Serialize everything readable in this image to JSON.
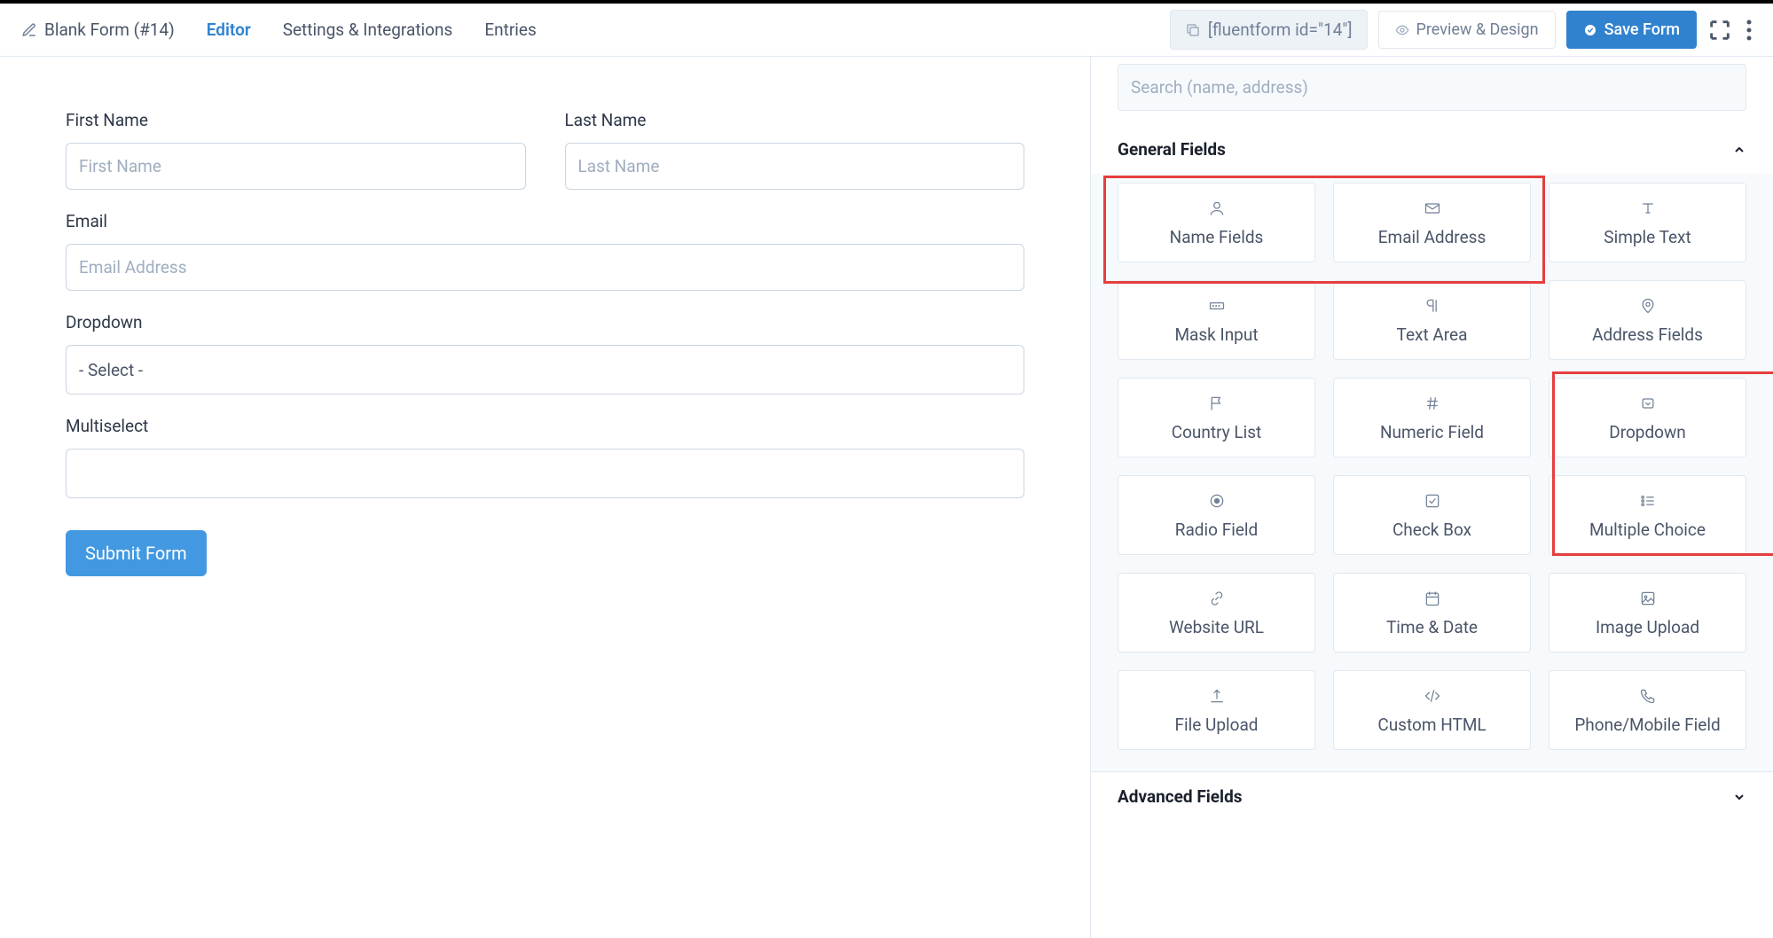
{
  "header": {
    "form_title": "Blank Form (#14)",
    "nav": {
      "editor": "Editor",
      "settings": "Settings & Integrations",
      "entries": "Entries"
    },
    "shortcode": "[fluentform id=\"14\"]",
    "preview": "Preview & Design",
    "save": "Save Form"
  },
  "canvas": {
    "first_name": {
      "label": "First Name",
      "placeholder": "First Name"
    },
    "last_name": {
      "label": "Last Name",
      "placeholder": "Last Name"
    },
    "email": {
      "label": "Email",
      "placeholder": "Email Address"
    },
    "dropdown": {
      "label": "Dropdown",
      "placeholder": "- Select -"
    },
    "multiselect": {
      "label": "Multiselect"
    },
    "submit": "Submit Form"
  },
  "sidebar": {
    "search_placeholder": "Search (name, address)",
    "general_title": "General Fields",
    "advanced_title": "Advanced Fields",
    "tiles": {
      "name_fields": "Name Fields",
      "email_address": "Email Address",
      "simple_text": "Simple Text",
      "mask_input": "Mask Input",
      "text_area": "Text Area",
      "address_fields": "Address Fields",
      "country_list": "Country List",
      "numeric_field": "Numeric Field",
      "dropdown": "Dropdown",
      "radio_field": "Radio Field",
      "check_box": "Check Box",
      "multiple_choice": "Multiple Choice",
      "website_url": "Website URL",
      "time_date": "Time & Date",
      "image_upload": "Image Upload",
      "file_upload": "File Upload",
      "custom_html": "Custom HTML",
      "phone_field": "Phone/Mobile Field"
    }
  }
}
